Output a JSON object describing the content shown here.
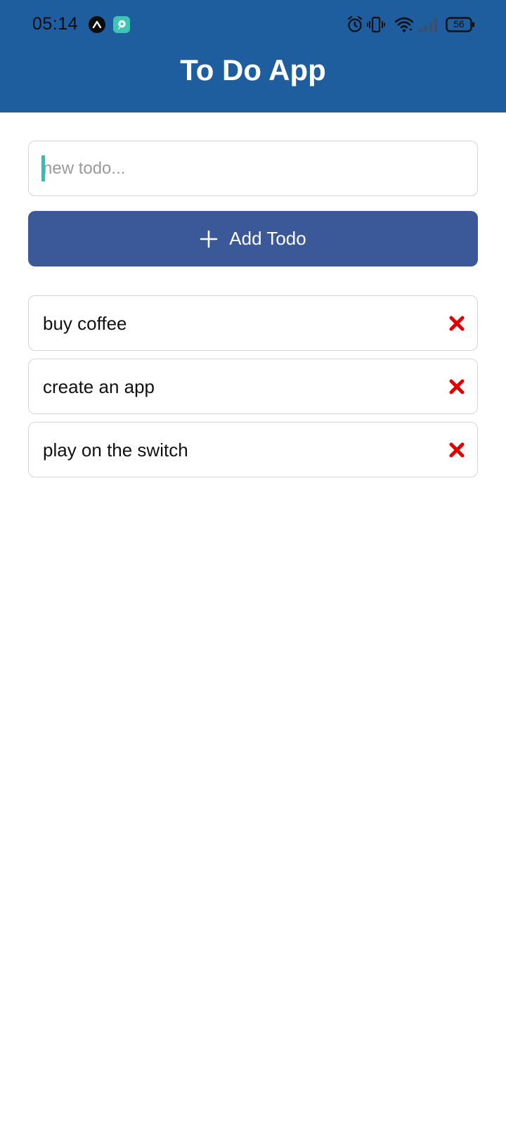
{
  "status_bar": {
    "time": "05:14",
    "battery": "56",
    "icons": [
      "app-notification-icon",
      "chat-notification-icon",
      "alarm-icon",
      "vibrate-icon",
      "wifi-icon",
      "signal-icon",
      "battery-icon"
    ]
  },
  "header": {
    "title": "To Do App"
  },
  "input": {
    "placeholder": "new todo...",
    "value": ""
  },
  "add_button": {
    "label": "Add Todo",
    "icon": "plus-icon"
  },
  "todos": [
    {
      "text": "buy coffee",
      "delete_icon": "delete-x-icon"
    },
    {
      "text": "create an app",
      "delete_icon": "delete-x-icon"
    },
    {
      "text": "play on the switch",
      "delete_icon": "delete-x-icon"
    }
  ],
  "colors": {
    "header": "#1e5e9e",
    "button": "#3b5998",
    "delete": "#e00000",
    "caret": "#2bc3b0"
  }
}
